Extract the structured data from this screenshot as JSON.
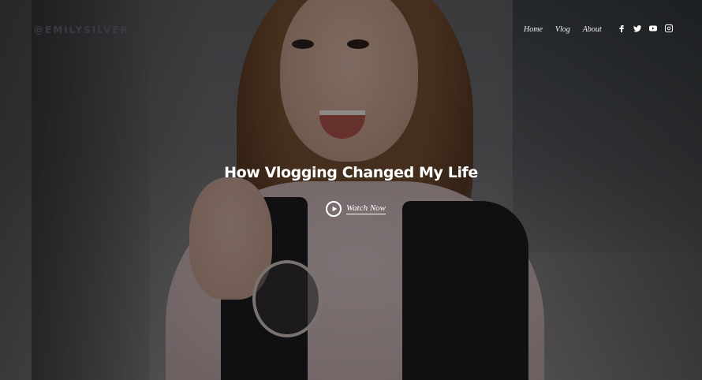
{
  "site": {
    "logo": "@EMILYSILVER"
  },
  "nav": {
    "items": [
      "Home",
      "Vlog",
      "About"
    ]
  },
  "social": {
    "icons": [
      "facebook-icon",
      "twitter-icon",
      "youtube-icon",
      "instagram-icon"
    ]
  },
  "hero": {
    "headline": "How Vlogging Changed My Life",
    "cta_label": "Watch Now"
  },
  "colors": {
    "text": "#ffffff",
    "logo": "#3c3a40",
    "overlay": "rgba(0,0,0,0.42)"
  }
}
